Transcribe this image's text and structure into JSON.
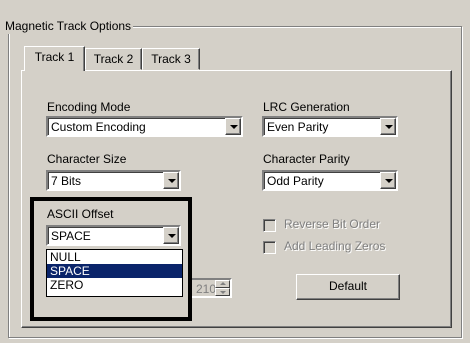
{
  "group": {
    "title": "Magnetic Track Options"
  },
  "tabs": [
    {
      "label": "Track 1",
      "active": true
    },
    {
      "label": "Track 2",
      "active": false
    },
    {
      "label": "Track 3",
      "active": false
    }
  ],
  "encoding_mode": {
    "label": "Encoding Mode",
    "value": "Custom Encoding"
  },
  "lrc_generation": {
    "label": "LRC Generation",
    "value": "Even Parity"
  },
  "character_size": {
    "label": "Character Size",
    "value": "7 Bits"
  },
  "character_parity": {
    "label": "Character Parity",
    "value": "Odd Parity"
  },
  "ascii_offset": {
    "label": "ASCII Offset",
    "value": "SPACE",
    "options": [
      "NULL",
      "SPACE",
      "ZERO"
    ],
    "selected_option": "SPACE"
  },
  "checkboxes": {
    "reverse_bit_order": {
      "label": "Reverse Bit Order",
      "checked": false,
      "enabled": false
    },
    "add_leading_zeros": {
      "label": "Add Leading Zeros",
      "checked": false,
      "enabled": false
    }
  },
  "spinner": {
    "value": "210",
    "enabled": false
  },
  "buttons": {
    "default_label": "Default"
  },
  "colors": {
    "face": "#d4d0c8",
    "highlight": "#0a246a",
    "callout": "#000000"
  }
}
